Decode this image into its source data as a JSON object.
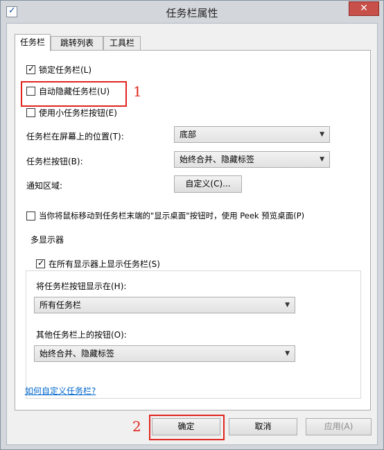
{
  "window": {
    "title": "任务栏属性",
    "close_label": "✕"
  },
  "tabs": [
    {
      "label": "任务栏",
      "active": true
    },
    {
      "label": "跳转列表",
      "active": false
    },
    {
      "label": "工具栏",
      "active": false
    }
  ],
  "options": {
    "lock_taskbar": {
      "label": "锁定任务栏(L)",
      "checked": true
    },
    "auto_hide": {
      "label": "自动隐藏任务栏(U)",
      "checked": false
    },
    "small_buttons": {
      "label": "使用小任务栏按钮(E)",
      "checked": false
    },
    "position_label": "任务栏在屏幕上的位置(T):",
    "position_value": "底部",
    "buttons_label": "任务栏按钮(B):",
    "buttons_value": "始终合并、隐藏标签",
    "notify_label": "通知区域:",
    "customize_button": "自定义(C)...",
    "peek": {
      "label": "当你将鼠标移动到任务栏末端的\"显示桌面\"按钮时，使用 Peek 预览桌面(P)",
      "checked": false
    }
  },
  "multi_display": {
    "title": "多显示器",
    "show_all": {
      "label": "在所有显示器上显示任务栏(S)",
      "checked": true
    },
    "show_on_label": "将任务栏按钮显示在(H):",
    "show_on_value": "所有任务栏",
    "other_label": "其他任务栏上的按钮(O):",
    "other_value": "始终合并、隐藏标签"
  },
  "help_link": "如何自定义任务栏?",
  "footer": {
    "ok": "确定",
    "cancel": "取消",
    "apply": "应用(A)"
  },
  "annotations": {
    "marker_1": "1",
    "marker_2": "2",
    "color": "#e0241c"
  },
  "icons": {
    "dropdown": "▼",
    "check": "✓"
  }
}
